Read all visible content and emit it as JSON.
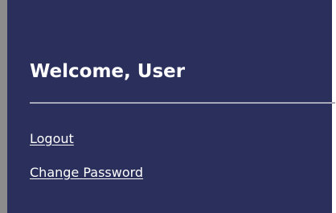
{
  "welcome": {
    "title": "Welcome, User"
  },
  "links": {
    "logout": "Logout",
    "change_password": "Change Password"
  },
  "colors": {
    "panel_background": "#2b2f5c",
    "left_border": "#8c8c8c",
    "text": "#ffffff",
    "divider": "#a8a8b8"
  }
}
